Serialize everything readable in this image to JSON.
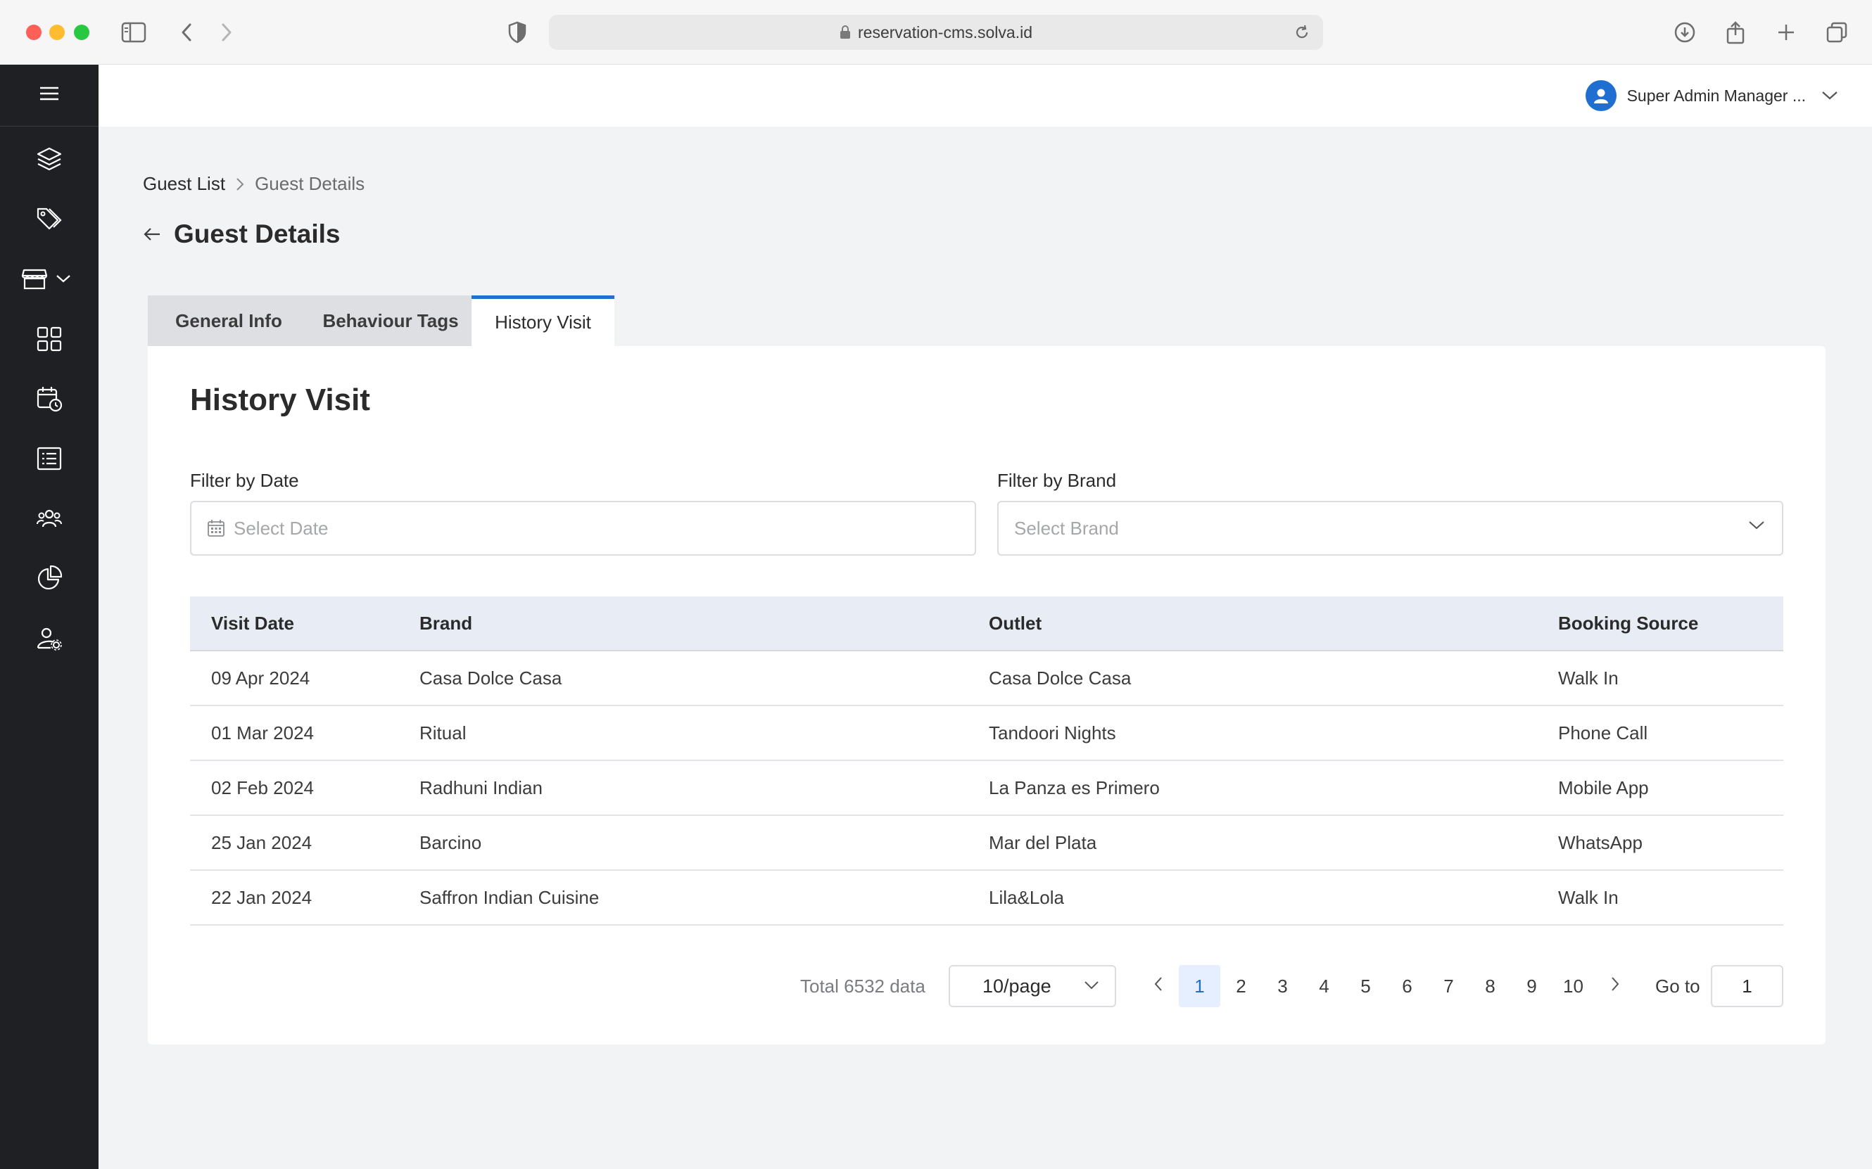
{
  "browser": {
    "url": "reservation-cms.solva.id",
    "icons": [
      "sidebar-toggle-icon",
      "back-icon",
      "forward-icon",
      "shield-icon",
      "lock-icon",
      "reload-icon",
      "download-icon",
      "share-icon",
      "new-tab-icon",
      "tabs-overview-icon"
    ]
  },
  "sidebar": {
    "menu_icon": "hamburger-icon",
    "items": [
      {
        "icon": "layers-icon"
      },
      {
        "icon": "tag-icon"
      },
      {
        "icon": "store-icon",
        "has_chevron": true
      },
      {
        "icon": "grid-icon"
      },
      {
        "icon": "calendar-clock-icon"
      },
      {
        "icon": "list-icon"
      },
      {
        "icon": "users-icon"
      },
      {
        "icon": "pie-chart-icon"
      },
      {
        "icon": "user-settings-icon"
      }
    ]
  },
  "header": {
    "user_name": "Super Admin Manager ..."
  },
  "breadcrumb": {
    "items": [
      "Guest List",
      "Guest Details"
    ]
  },
  "page": {
    "title": "Guest Details"
  },
  "tabs": [
    {
      "label": "General Info",
      "active": false
    },
    {
      "label": "Behaviour Tags",
      "active": false
    },
    {
      "label": "History Visit",
      "active": true
    }
  ],
  "history": {
    "title": "History Visit",
    "filter_date_label": "Filter by Date",
    "filter_date_placeholder": "Select Date",
    "filter_brand_label": "Filter by Brand",
    "filter_brand_placeholder": "Select Brand",
    "columns": [
      "Visit Date",
      "Brand",
      "Outlet",
      "Booking Source"
    ],
    "rows": [
      [
        "09 Apr 2024",
        "Casa Dolce Casa",
        "Casa Dolce Casa",
        "Walk In"
      ],
      [
        "01 Mar 2024",
        "Ritual",
        "Tandoori Nights",
        "Phone Call"
      ],
      [
        "02 Feb 2024",
        "Radhuni Indian",
        "La Panza es Primero",
        "Mobile App"
      ],
      [
        "25 Jan 2024",
        "Barcino",
        "Mar del Plata",
        "WhatsApp"
      ],
      [
        "22 Jan 2024",
        "Saffron Indian Cuisine",
        "Lila&Lola",
        "Walk In"
      ]
    ]
  },
  "pagination": {
    "total_text": "Total 6532 data",
    "page_size": "10/page",
    "pages": [
      "1",
      "2",
      "3",
      "4",
      "5",
      "6",
      "7",
      "8",
      "9",
      "10"
    ],
    "current_page": "1",
    "goto_label": "Go to",
    "goto_value": "1"
  },
  "colors": {
    "accent": "#1f6fd1",
    "sidebar_bg": "#1f2023",
    "table_header_bg": "#e8edf5",
    "page_bg": "#f2f3f5"
  }
}
